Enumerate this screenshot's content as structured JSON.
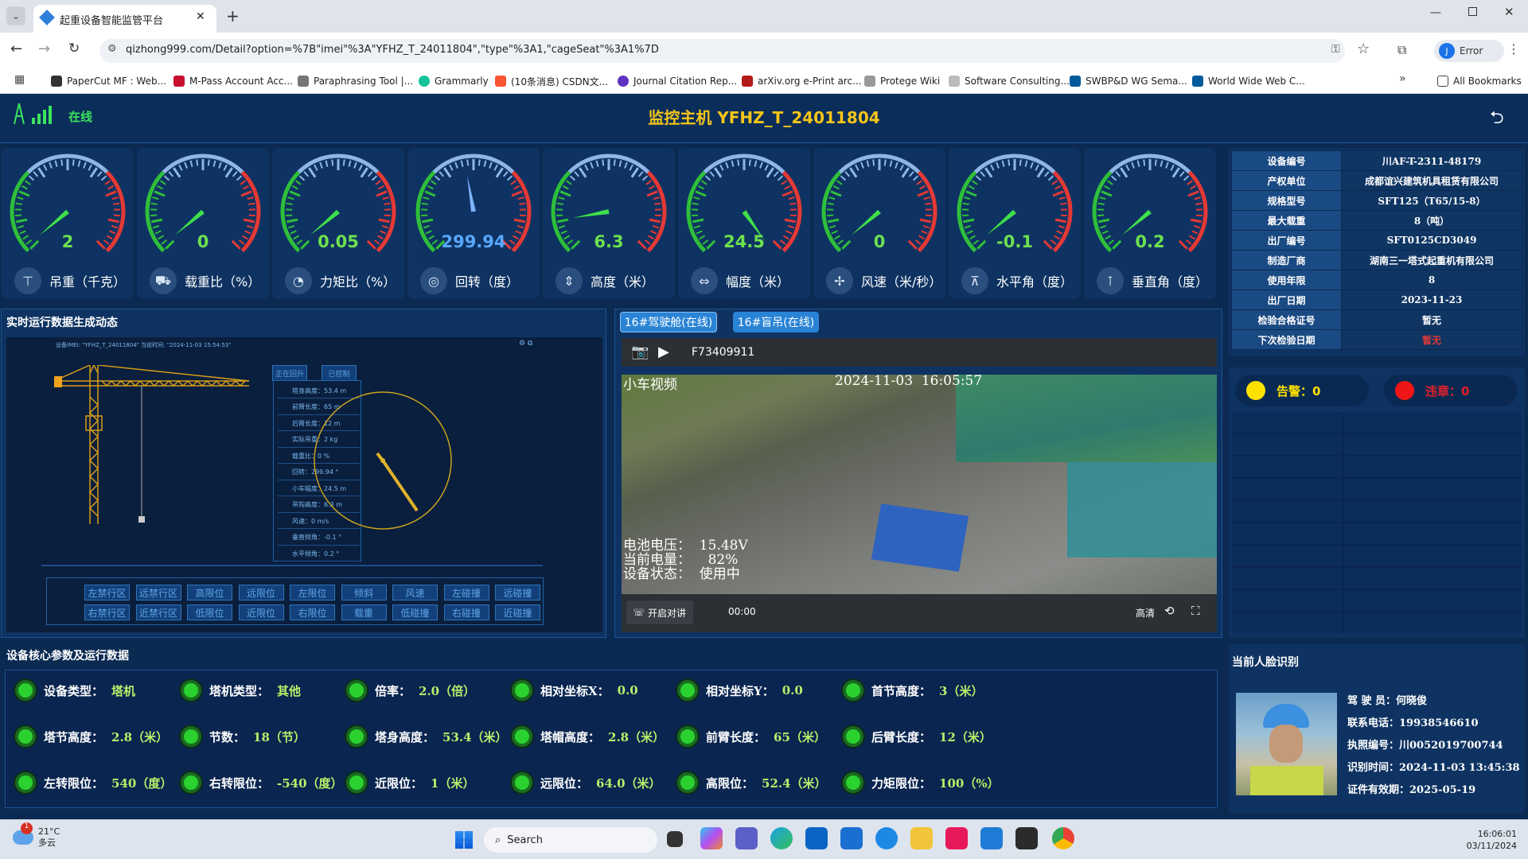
{
  "browser": {
    "tab_title": "起重设备智能监管平台",
    "url": "qizhong999.com/Detail?option=%7B\"imei\"%3A\"YFHZ_T_24011804\",\"type\"%3A1,\"cageSeat\"%3A1%7D",
    "profile": "J",
    "profile_label": "Error",
    "bookmarks": [
      "PaperCut MF : Web...",
      "M-Pass Account Acc...",
      "Paraphrasing Tool |...",
      "Grammarly",
      "(10条消息) CSDN文...",
      "Journal Citation Rep...",
      "arXiv.org e-Print arc...",
      "Protege Wiki",
      "Software Consulting...",
      "SWBP&D WG Sema...",
      "World Wide Web C..."
    ],
    "all_bookmarks": "All Bookmarks"
  },
  "header": {
    "status": "在线",
    "title": "监控主机 YFHZ_T_24011804"
  },
  "gauges": [
    {
      "value": "2",
      "label": "吊重（千克）",
      "icon": "hook-icon",
      "needle": -130
    },
    {
      "value": "0",
      "label": "载重比（%）",
      "icon": "crane-icon",
      "needle": -130
    },
    {
      "value": "0.05",
      "label": "力矩比（%）",
      "icon": "pie-icon",
      "needle": -130
    },
    {
      "value": "299.94",
      "label": "回转（度）",
      "icon": "compass-icon",
      "needle": -10
    },
    {
      "value": "6.3",
      "label": "高度（米）",
      "icon": "height-icon",
      "needle": -100
    },
    {
      "value": "24.5",
      "label": "幅度（米）",
      "icon": "range-icon",
      "needle": 145
    },
    {
      "value": "0",
      "label": "风速（米/秒）",
      "icon": "fan-icon",
      "needle": -130
    },
    {
      "value": "-0.1",
      "label": "水平角（度）",
      "icon": "level-icon",
      "needle": -130
    },
    {
      "value": "0.2",
      "label": "垂直角（度）",
      "icon": "tilt-icon",
      "needle": -130
    }
  ],
  "device_info": [
    [
      "设备编号",
      "川AF-T-2311-48179"
    ],
    [
      "产权单位",
      "成都谊兴建筑机具租赁有限公司"
    ],
    [
      "规格型号",
      "SFT125（T65/15-8）"
    ],
    [
      "最大载重",
      "8（吨）"
    ],
    [
      "出厂编号",
      "SFT0125CD3049"
    ],
    [
      "制造厂商",
      "湖南三一塔式起重机有限公司"
    ],
    [
      "使用年限",
      "8"
    ],
    [
      "出厂日期",
      "2023-11-23"
    ],
    [
      "检验合格证号",
      "暂无"
    ],
    [
      "下次检验日期",
      "暂无"
    ]
  ],
  "alarms": {
    "warning": "告警：0",
    "violation": "违章：0"
  },
  "realtime": {
    "title": "实时运行数据生成动态",
    "imei_line": "设备IMEI: \"YFHZ_T_24011804\"   当前时间: \"2024-11-03 15:54:53\"",
    "btn1": "正在回升",
    "btn2": "已控制",
    "info": [
      "塔身高度：53.4 m",
      "前臂长度：65 m",
      "后臂长度：12 m",
      "实际吊重：2 kg",
      "载重比：0 %",
      "回转：299.94 °",
      "小车幅度：24.5 m",
      "吊钩高度：6.3 m",
      "风速：0 m/s",
      "垂直倾角：-0.1 °",
      "水平倾角：0.2 °"
    ],
    "buttons_row1": [
      "左禁行区",
      "远禁行区",
      "高限位",
      "远限位",
      "左限位",
      "倾斜",
      "风速",
      "左碰撞",
      "远碰撞"
    ],
    "buttons_row2": [
      "右禁行区",
      "近禁行区",
      "低限位",
      "近限位",
      "右限位",
      "载重",
      "低碰撞",
      "右碰撞",
      "近碰撞"
    ]
  },
  "video": {
    "tab1": "16#驾驶舱(在线)",
    "tab2": "16#盲吊(在线)",
    "camera_id": "F73409911",
    "osd_title": "小车视频",
    "osd_time": "2024-11-03  16:05:57",
    "osd_l1": "电池电压：  15.48V",
    "osd_l2": "当前电量：    82%",
    "osd_l3": "设备状态：  使用中",
    "talk": "开启对讲",
    "time": "00:00",
    "quality": "高清"
  },
  "core": {
    "title": "设备核心参数及运行数据",
    "items": [
      [
        "设备类型：",
        "塔机"
      ],
      [
        "塔机类型：",
        "其他"
      ],
      [
        "倍率：",
        "2.0（倍）"
      ],
      [
        "相对坐标X：",
        "0.0"
      ],
      [
        "相对坐标Y：",
        "0.0"
      ],
      [
        "首节高度：",
        "3（米）"
      ],
      [
        "塔节高度：",
        "2.8（米）"
      ],
      [
        "节数：",
        "18（节）"
      ],
      [
        "塔身高度：",
        "53.4（米）"
      ],
      [
        "塔帽高度：",
        "2.8（米）"
      ],
      [
        "前臂长度：",
        "65（米）"
      ],
      [
        "后臂长度：",
        "12（米）"
      ],
      [
        "左转限位：",
        "540（度）"
      ],
      [
        "右转限位：",
        "-540（度）"
      ],
      [
        "近限位：",
        "1（米）"
      ],
      [
        "远限位：",
        "64.0（米）"
      ],
      [
        "高限位：",
        "52.4（米）"
      ],
      [
        "力矩限位：",
        "100（%）"
      ]
    ]
  },
  "face": {
    "title": "当前人脸识别",
    "rows": [
      "驾 驶 员：何晓俊",
      "联系电话：19938546610",
      "执照编号：川0052019700744",
      "识别时间：2024-11-03 13:45:38",
      "证件有效期：2025-05-19"
    ]
  },
  "taskbar": {
    "temp": "21°C",
    "weather": "多云",
    "search": "Search",
    "time": "16:06:01",
    "date": "03/11/2024"
  }
}
